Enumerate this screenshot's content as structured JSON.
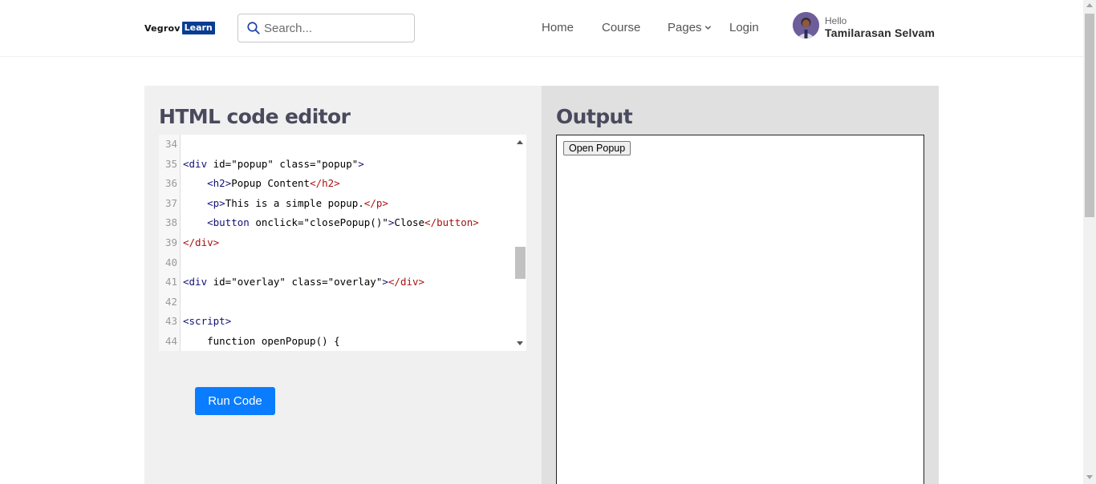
{
  "header": {
    "logo_part1": "Vegrov",
    "logo_part2": "Learn",
    "search_placeholder": "Search...",
    "nav": {
      "home": "Home",
      "course": "Course",
      "pages": "Pages",
      "login": "Login"
    },
    "greeting": "Hello",
    "user_name": "Tamilarasan Selvam"
  },
  "editor_panel": {
    "title": "HTML code editor",
    "lines": [
      {
        "num": "34",
        "text": ""
      },
      {
        "num": "35",
        "text": "<div id=\"popup\" class=\"popup\">"
      },
      {
        "num": "36",
        "text": "    <h2>Popup Content</h2>"
      },
      {
        "num": "37",
        "text": "    <p>This is a simple popup.</p>"
      },
      {
        "num": "38",
        "text": "    <button onclick=\"closePopup()\">Close</button>"
      },
      {
        "num": "39",
        "text": "</div>"
      },
      {
        "num": "40",
        "text": ""
      },
      {
        "num": "41",
        "text": "<div id=\"overlay\" class=\"overlay\"></div>"
      },
      {
        "num": "42",
        "text": ""
      },
      {
        "num": "43",
        "text": "<script>"
      },
      {
        "num": "44",
        "text": "    function openPopup() {"
      }
    ],
    "run_label": "Run Code"
  },
  "output_panel": {
    "title": "Output",
    "button_label": "Open Popup"
  },
  "colors": {
    "accent": "#0a7cff",
    "logo_badge": "#0a3d91",
    "tag_open": "#111177",
    "tag_close": "#aa1111"
  }
}
